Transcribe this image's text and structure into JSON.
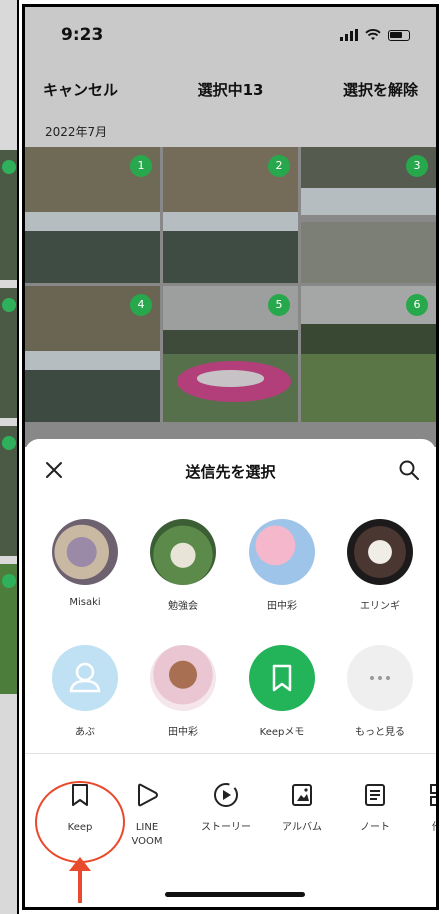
{
  "status_bar": {
    "time": "9:23"
  },
  "top_nav": {
    "cancel_label": "キャンセル",
    "title": "選択中13",
    "deselect_label": "選択を解除"
  },
  "date_header": "2022年7月",
  "photo_badges": [
    "1",
    "2",
    "3",
    "4",
    "5",
    "6"
  ],
  "share_sheet": {
    "title": "送信先を選択",
    "friends_row1": [
      {
        "name": "Misaki"
      },
      {
        "name": "勉強会"
      },
      {
        "name": "田中彩"
      },
      {
        "name": "エリンギ"
      }
    ],
    "friends_row2": [
      {
        "name": "あぶ"
      },
      {
        "name": "田中彩"
      },
      {
        "name": "Keepメモ"
      },
      {
        "name": "もっと見る"
      }
    ],
    "actions": [
      {
        "label": "Keep",
        "icon": "bookmark-icon"
      },
      {
        "label": "LINE\nVOOM",
        "icon": "voom-icon"
      },
      {
        "label": "ストーリー",
        "icon": "story-icon"
      },
      {
        "label": "アルバム",
        "icon": "album-icon"
      },
      {
        "label": "ノート",
        "icon": "note-icon"
      },
      {
        "label": "他の",
        "icon": "other-icon"
      }
    ]
  },
  "colors": {
    "accent_green": "#23b45a",
    "highlight_red": "#e84a2c",
    "dim_overlay": "#c9c9c9"
  }
}
